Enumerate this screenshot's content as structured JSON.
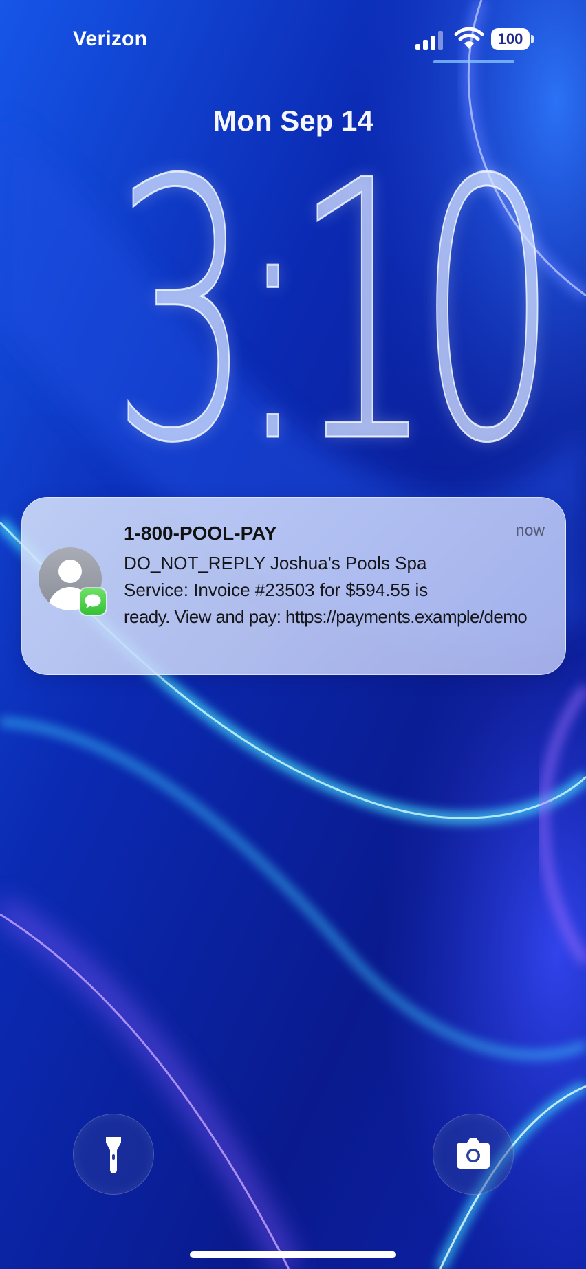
{
  "status_bar": {
    "carrier": "Verizon",
    "signal_icon": "cellular-signal-icon",
    "wifi_icon": "wifi-icon",
    "battery_level": "100"
  },
  "lock_screen": {
    "date": "Mon Sep 14",
    "time": "3:10"
  },
  "notification": {
    "app_icon": "messages-icon",
    "sender": "1-800-POOL-PAY",
    "timestamp": "now",
    "body_lines": [
      "DO_NOT_REPLY Joshua's Pools Spa",
      "Service: Invoice #23503 for $594.55 is",
      "ready. View and pay: https://payments.example/demo"
    ]
  },
  "quick_actions": {
    "left_icon": "flashlight-icon",
    "right_icon": "camera-icon"
  },
  "colors": {
    "wallpaper_deep": "#0b1c9a",
    "wallpaper_cyan": "#39d4ff",
    "wallpaper_violet": "#9b55ff",
    "messages_green": "#35c234"
  }
}
